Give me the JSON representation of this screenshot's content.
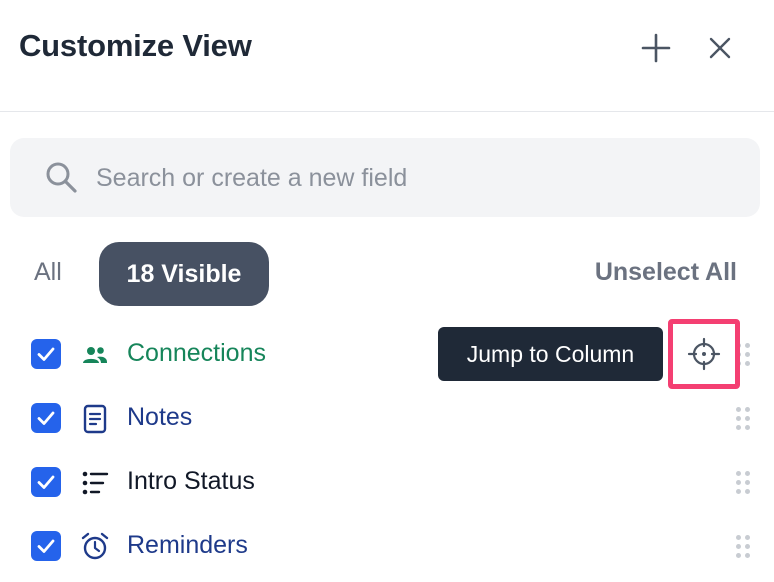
{
  "header": {
    "title": "Customize View",
    "add_icon": "plus-icon",
    "close_icon": "close-icon"
  },
  "search": {
    "placeholder": "Search or create a new field",
    "value": "",
    "icon": "search-icon"
  },
  "filters": {
    "all_label": "All",
    "visible_label": "18 Visible",
    "unselect_label": "Unselect All"
  },
  "fields": [
    {
      "label": "Connections",
      "icon": "people-icon",
      "checked": true,
      "color": "#16855a"
    },
    {
      "label": "Notes",
      "icon": "document-icon",
      "checked": true,
      "color": "#1e3a8a"
    },
    {
      "label": "Intro Status",
      "icon": "list-icon",
      "checked": true,
      "color": "#111827"
    },
    {
      "label": "Reminders",
      "icon": "alarm-clock-icon",
      "checked": true,
      "color": "#1e3a8a"
    }
  ],
  "tooltip": {
    "text": "Jump to Column",
    "target_icon": "crosshair-icon"
  },
  "colors": {
    "checkbox": "#2563eb",
    "pill": "#475163",
    "tooltip_bg": "#1f2937",
    "highlight": "#f43f72"
  }
}
